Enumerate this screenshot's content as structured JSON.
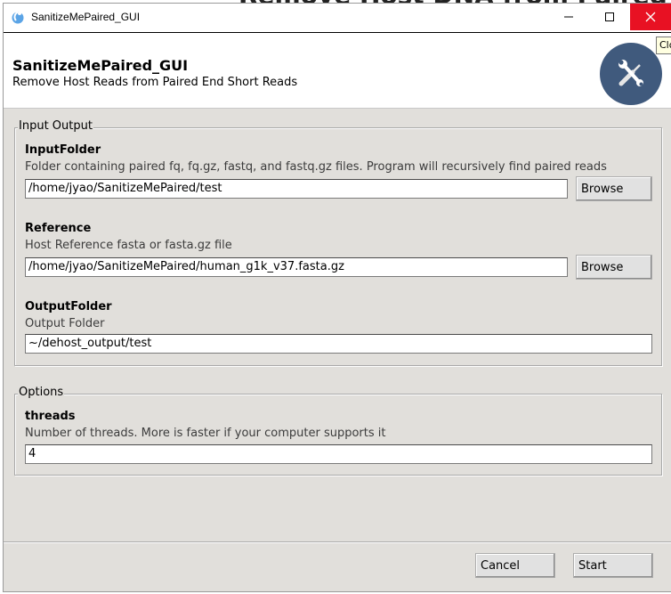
{
  "background_window": {
    "partial_title": "Remove Host DNA from Paired R",
    "tooltip": "Clo"
  },
  "window": {
    "title": "SanitizeMePaired_GUI",
    "close_color": "#e81123"
  },
  "header": {
    "title": "SanitizeMePaired_GUI",
    "subtitle": "Remove Host Reads from Paired End Short Reads",
    "logo_icon": "tools-icon",
    "logo_color": "#405a7d"
  },
  "input_output": {
    "legend": "Input Output",
    "input_folder": {
      "label": "InputFolder",
      "description": "Folder containing paired fq, fq.gz, fastq, and fastq.gz files. Program will recursively find paired reads",
      "value": "/home/jyao/SanitizeMePaired/test",
      "browse_label": "Browse"
    },
    "reference": {
      "label": "Reference",
      "description": "Host Reference fasta or fasta.gz file",
      "value": "/home/jyao/SanitizeMePaired/human_g1k_v37.fasta.gz",
      "browse_label": "Browse"
    },
    "output_folder": {
      "label": "OutputFolder",
      "description": "Output Folder",
      "value": "~/dehost_output/test"
    }
  },
  "options": {
    "legend": "Options",
    "threads": {
      "label": "threads",
      "description": "Number of threads. More is faster if your computer supports it",
      "value": "4"
    }
  },
  "footer": {
    "cancel_label": "Cancel",
    "start_label": "Start"
  }
}
